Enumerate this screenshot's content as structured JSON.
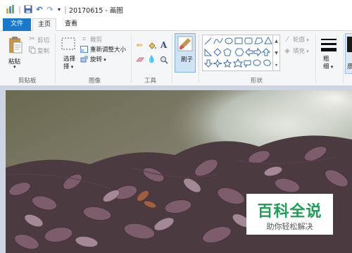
{
  "window": {
    "title": "20170615 - 画图"
  },
  "tabs": {
    "file": "文件",
    "home": "主页",
    "view": "查看"
  },
  "clipboard": {
    "paste": "粘贴",
    "cut": "剪切",
    "copy": "复制",
    "group": "剪贴板"
  },
  "image": {
    "select": "选择",
    "crop": "裁剪",
    "resize": "重新调整大小",
    "rotate": "旋转",
    "group": "图像"
  },
  "tools": {
    "group": "工具"
  },
  "brushes": {
    "label": "刷子"
  },
  "shapes": {
    "outline": "轮廓",
    "fill": "填充",
    "group": "形状"
  },
  "size": {
    "label": "粗细"
  },
  "colors": {
    "active": "#1a1a1a",
    "accent": "#1979ca"
  },
  "watermark": {
    "title": "百科全说",
    "subtitle": "助你轻松解决",
    "color": "#1f9e55"
  }
}
